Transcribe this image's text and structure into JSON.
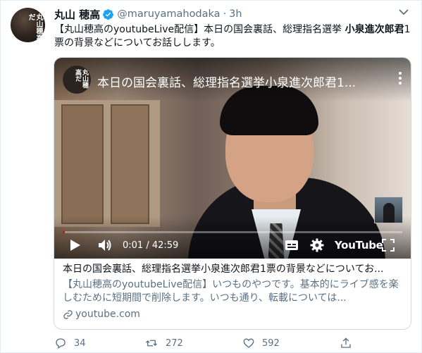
{
  "tweet": {
    "display_name": "丸山 穂高",
    "handle": "@maruyamahodaka",
    "separator": "·",
    "time": "3h",
    "avatar_text": "丸山穂高だ",
    "text_part1": "【丸山穂高のyoutubeLive配信】本日の国会裏話、総理指名選挙 ",
    "text_bold": "小泉進次郎君",
    "text_part2": "1票の背景などについてお話しします。"
  },
  "video": {
    "channel_icon_text": "丸山穂高だ",
    "title": "本日の国会裏話、総理指名選挙小泉進次郎君1...",
    "time_display": "0:01 / 42:59",
    "logo": "YouTube",
    "progress_fraction": 0.0004
  },
  "card": {
    "title": "本日の国会裏話、総理指名選挙小泉進次郎君1票の背景などについてお...",
    "description": "【丸山穂高のyoutubeLive配信】いつものやつです。基本的にライブ感を楽しむために短期間で削除します。いつも通り、転載については...",
    "domain": "youtube.com"
  },
  "actions": {
    "replies": "34",
    "retweets": "272",
    "likes": "592"
  },
  "colors": {
    "verified": "#1da1f2",
    "secondary_text": "#5b7083",
    "progress": "#ff0000"
  }
}
